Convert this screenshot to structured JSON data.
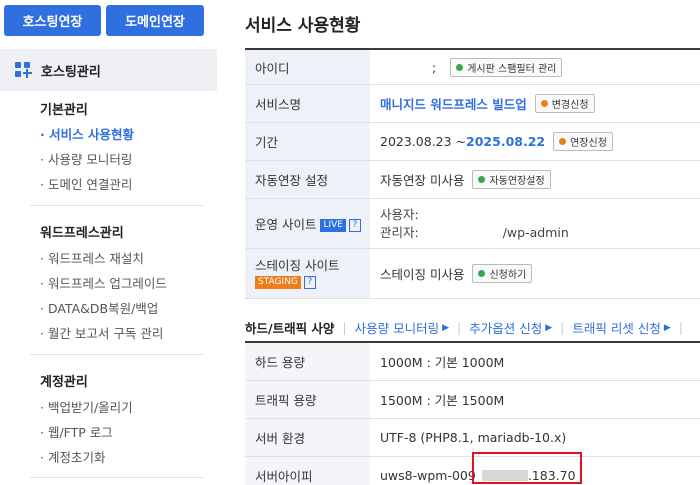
{
  "sidebar": {
    "btn_hosting": "호스팅연장",
    "btn_domain": "도메인연장",
    "section_label": "호스팅관리",
    "groups": [
      {
        "title": "기본관리",
        "items": [
          "· 서비스 사용현황",
          "· 사용량 모니터링",
          "· 도메인 연결관리"
        ]
      },
      {
        "title": "워드프레스관리",
        "items": [
          "· 워드프레스 재설치",
          "· 워드프레스 업그레이드",
          "· DATA&DB복원/백업",
          "· 월간 보고서 구독 관리"
        ]
      },
      {
        "title": "계정관리",
        "items": [
          "· 백업받기/올리기",
          "· 웹/FTP 로그",
          "· 계정초기화"
        ]
      }
    ]
  },
  "main": {
    "title": "서비스 사용현황",
    "info_rows": {
      "id": {
        "label": "아이디",
        "value": ";",
        "btn": "게시판 스팸필터 관리"
      },
      "service": {
        "label": "서비스명",
        "value": "매니지드 워드프레스 빌드업",
        "btn": "변경신청"
      },
      "period": {
        "label": "기간",
        "start": "2023.08.23 ~ ",
        "end": "2025.08.22",
        "btn": "연장신청"
      },
      "auto": {
        "label": "자동연장 설정",
        "value": "자동연장 미사용",
        "btn": "자동연장설정"
      },
      "live": {
        "label": "운영 사이트",
        "badge": "LIVE",
        "q": "?",
        "user_label": "사용자:",
        "admin_label": "관리자:",
        "admin_value": "/wp-admin"
      },
      "staging": {
        "label": "스테이징 사이트",
        "badge": "STAGING",
        "q": "?",
        "value": "스테이징 미사용",
        "btn": "신청하기"
      }
    },
    "sub_head": {
      "title": "하드/트래픽 사양",
      "links": [
        "사용량 모니터링",
        "추가옵션 신청",
        "트래픽 리셋 신청"
      ]
    },
    "spec_rows": [
      {
        "label": "하드 용량",
        "value": "1000M : 기본 1000M"
      },
      {
        "label": "트래픽 용량",
        "value": "1500M : 기본 1500M"
      },
      {
        "label": "서버 환경",
        "value": "UTF-8 (PHP8.1, mariadb-10.x)"
      },
      {
        "label": "서버아이피",
        "value": "uws8-wpm-009",
        "ip_tail": ".183.70"
      }
    ]
  },
  "colors": {
    "accent": "#2f6fe0",
    "orange": "#ef7d1a",
    "green": "#3aa64a",
    "highlight": "#e0141e"
  }
}
